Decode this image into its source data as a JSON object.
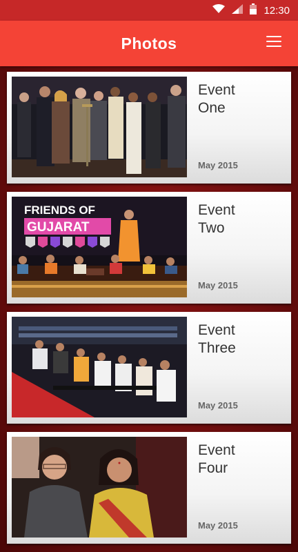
{
  "status": {
    "time": "12:30"
  },
  "header": {
    "title": "Photos"
  },
  "events": [
    {
      "line1": "Event",
      "line2": "One",
      "date": "May 2015"
    },
    {
      "line1": "Event",
      "line2": "Two",
      "date": "May 2015",
      "banner_line1": "FRIENDS OF",
      "banner_line2": "GUJARAT"
    },
    {
      "line1": "Event",
      "line2": "Three",
      "date": "May 2015"
    },
    {
      "line1": "Event",
      "line2": "Four",
      "date": "May 2015"
    }
  ]
}
